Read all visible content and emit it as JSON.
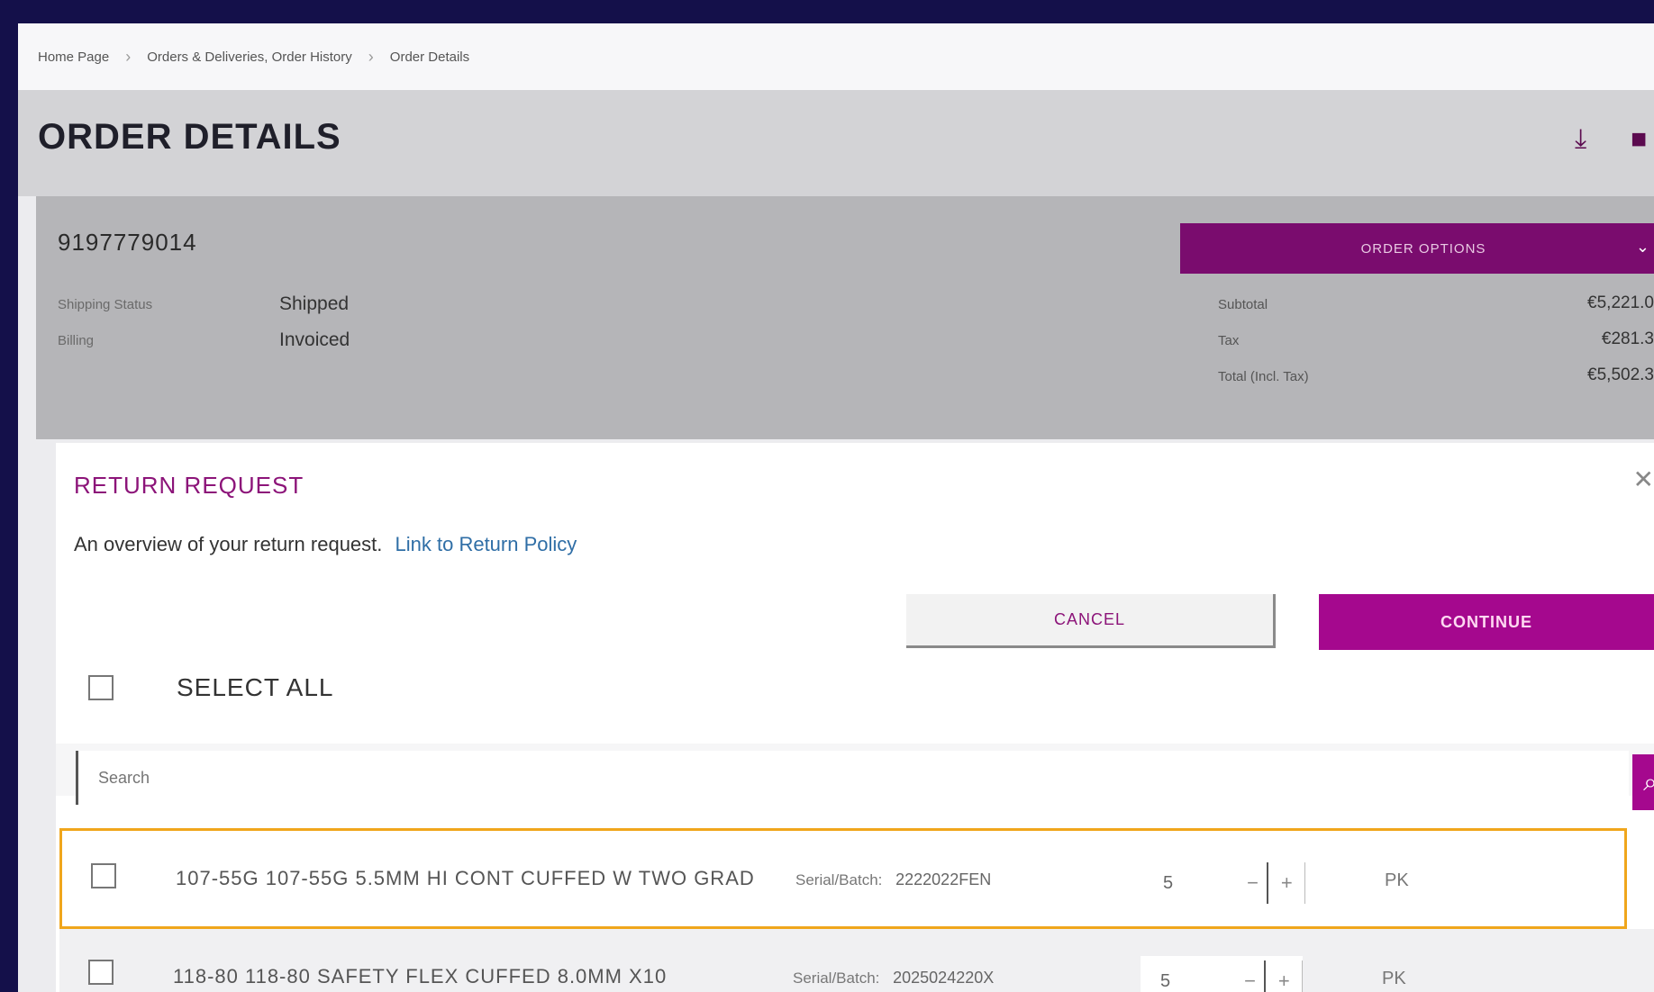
{
  "breadcrumb": {
    "items": [
      "Home Page",
      "Orders & Deliveries, Order History",
      "Order Details"
    ]
  },
  "header": {
    "title": "ORDER DETAILS",
    "download_icon": "download-icon",
    "print_icon": "print-icon"
  },
  "order": {
    "number": "9197779014",
    "shipping_label": "Shipping Status",
    "shipping_value": "Shipped",
    "billing_label": "Billing",
    "billing_value": "Invoiced",
    "options_label": "ORDER OPTIONS",
    "subtotal_label": "Subtotal",
    "subtotal_value": "€5,221.0",
    "tax_label": "Tax",
    "tax_value": "€281.3",
    "total_label": "Total (Incl. Tax)",
    "total_value": "€5,502.3"
  },
  "modal": {
    "title": "RETURN REQUEST",
    "description": "An overview of your return request.",
    "policy_link": "Link to Return Policy",
    "cancel_label": "CANCEL",
    "continue_label": "CONTINUE",
    "select_all_label": "SELECT ALL",
    "search_placeholder": "Search"
  },
  "items": [
    {
      "description": "107-55G 107-55G 5.5MM HI CONT CUFFED W TWO GRAD",
      "serial_label": "Serial/Batch:",
      "serial_value": "2222022FEN",
      "quantity": "5",
      "unit": "PK"
    },
    {
      "description": "118-80 118-80 SAFETY FLEX CUFFED 8.0MM X10",
      "serial_label": "Serial/Batch:",
      "serial_value": "2025024220X",
      "quantity": "5",
      "unit": "PK"
    }
  ],
  "colors": {
    "accent": "#a5088e",
    "dark_accent": "#7a0c6e",
    "highlight": "#f0a61c",
    "outer_frame": "#14104a"
  }
}
